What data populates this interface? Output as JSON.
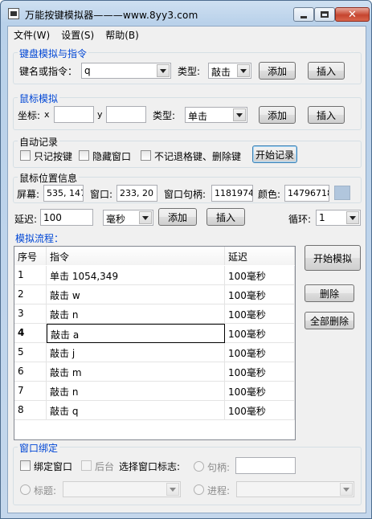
{
  "window": {
    "title": "万能按键模拟器———www.8yy3.com",
    "close_glyph": "✕"
  },
  "menu": [
    {
      "label": "文件(W)"
    },
    {
      "label": "设置(S)"
    },
    {
      "label": "帮助(B)"
    }
  ],
  "keyboard": {
    "group_title": "键盘模拟与指令",
    "key_label": "键名或指令：",
    "key_value": "q",
    "type_label": "类型:",
    "type_value": "敲击",
    "add_label": "添加",
    "insert_label": "插入"
  },
  "mouse": {
    "group_title": "鼠标模拟",
    "coord_label": "坐标:",
    "x_label": "x",
    "x_value": "",
    "y_label": "y",
    "y_value": "",
    "type_label": "类型:",
    "type_value": "单击",
    "add_label": "添加",
    "insert_label": "插入"
  },
  "autorecord": {
    "group_title": "自动记录",
    "opt_keys_only": "只记按键",
    "opt_hide_window": "隐藏窗口",
    "opt_no_backspace": "不记退格键、删除键",
    "start_label": "开始记录"
  },
  "mouseinfo": {
    "group_title": "鼠标位置信息",
    "screen_label": "屏幕:",
    "screen_value": "535, 147",
    "window_label": "窗口:",
    "window_value": "233, 20",
    "handle_label": "窗口句柄:",
    "handle_value": "1181974",
    "color_label": "颜色:",
    "color_value": "14796718",
    "swatch_color": "#b1c6dd"
  },
  "delay": {
    "label": "延迟:",
    "value": "100",
    "unit": "毫秒",
    "add_label": "添加",
    "insert_label": "插入",
    "loop_label": "循环:",
    "loop_value": "1"
  },
  "flow": {
    "title": "模拟流程：",
    "columns": [
      "序号",
      "指令",
      "延迟"
    ],
    "rows": [
      {
        "no": "1",
        "cmd": "单击 1054,349",
        "delay": "100毫秒"
      },
      {
        "no": "2",
        "cmd": "敲击 w",
        "delay": "100毫秒"
      },
      {
        "no": "3",
        "cmd": "敲击 n",
        "delay": "100毫秒"
      },
      {
        "no": "4",
        "cmd": "敲击 a",
        "delay": "100毫秒"
      },
      {
        "no": "5",
        "cmd": "敲击 j",
        "delay": "100毫秒"
      },
      {
        "no": "6",
        "cmd": "敲击 m",
        "delay": "100毫秒"
      },
      {
        "no": "7",
        "cmd": "敲击 n",
        "delay": "100毫秒"
      },
      {
        "no": "8",
        "cmd": "敲击 q",
        "delay": "100毫秒"
      }
    ],
    "start_label": "开始模拟",
    "delete_label": "删除",
    "delete_all_label": "全部删除"
  },
  "bind": {
    "group_title": "窗口绑定",
    "bind_window_label": "绑定窗口",
    "background_label": "后台",
    "select_label": "选择窗口标志:",
    "handle_label": "句柄:",
    "handle_value": "",
    "title_label": "标题:",
    "title_value": "",
    "process_label": "进程:",
    "process_value": ""
  }
}
